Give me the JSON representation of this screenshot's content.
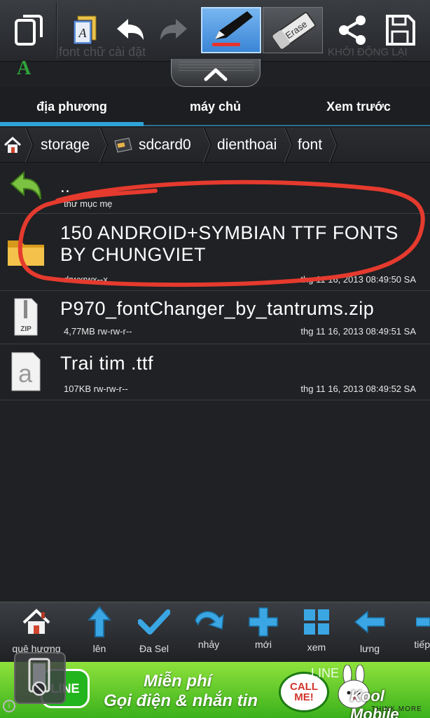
{
  "toolbar": {
    "ghost_title": "font chữ cài đặt",
    "ghost_restart": "KHỞI ĐỘNG LẠI",
    "eraser_label": "Erase",
    "pen_color": "#e8332d"
  },
  "tabs": [
    {
      "label": "địa phương",
      "active": true
    },
    {
      "label": "máy chủ",
      "active": false
    },
    {
      "label": "Xem trước",
      "active": false
    }
  ],
  "breadcrumb": [
    "storage",
    "sdcard0",
    "dienthoai",
    "font"
  ],
  "files": [
    {
      "name": "..",
      "meta": "thư mục mẹ",
      "date": "",
      "icon": "back-arrow-icon"
    },
    {
      "name": "150 ANDROID+SYMBIAN TTF FONTS BY CHUNGVIET",
      "meta": "drwxrwx--x",
      "date": "thg 11 16, 2013 08:49:50 SA",
      "icon": "folder-icon"
    },
    {
      "name": "P970_fontChanger_by_tantrums.zip",
      "meta": "4,77MB rw-rw-r--",
      "date": "thg 11 16, 2013 08:49:51 SA",
      "icon": "zip-file-icon"
    },
    {
      "name": "Trai tim .ttf",
      "meta": "107KB rw-rw-r--",
      "date": "thg 11 16, 2013 08:49:52 SA",
      "icon": "font-file-icon"
    }
  ],
  "bottom_bar": [
    {
      "label": "quê hương",
      "icon": "home-icon"
    },
    {
      "label": "lên",
      "icon": "arrow-up-icon"
    },
    {
      "label": "Đa Sel",
      "icon": "checkmark-icon"
    },
    {
      "label": "nhảy",
      "icon": "jump-arrow-icon"
    },
    {
      "label": "mới",
      "icon": "plus-icon"
    },
    {
      "label": "xem",
      "icon": "grid-view-icon"
    },
    {
      "label": "lưng",
      "icon": "arrow-left-icon"
    },
    {
      "label": "tiếp",
      "icon": "arrow-right-icon"
    }
  ],
  "ad": {
    "brand_badge": "LINE",
    "line1": "Miễn phí",
    "line2": "Gọi điện & nhắn tin",
    "bubble": "CALL ME!",
    "brand": "LINE",
    "watermark": "Kool Mobile",
    "watermark_sub": "THINK MORE"
  },
  "colors": {
    "accent": "#2fa3d8",
    "highlight_scribble": "#e53a2e"
  }
}
